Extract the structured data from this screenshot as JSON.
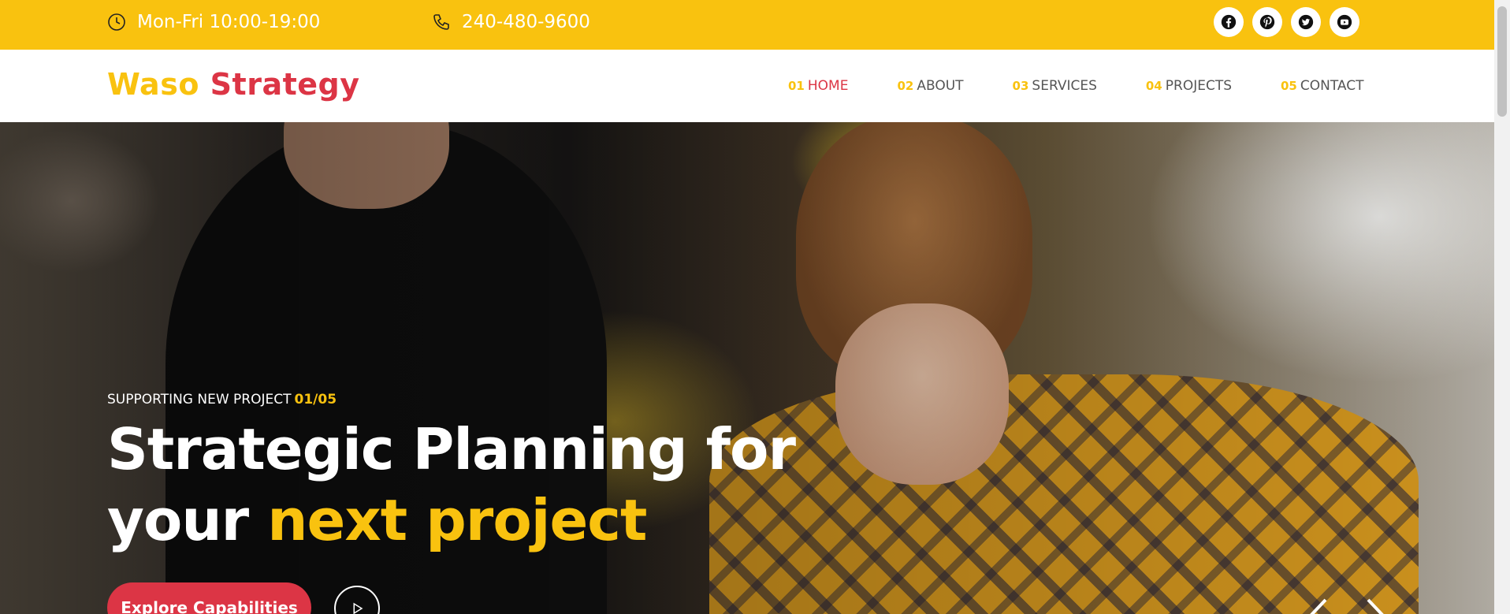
{
  "topbar": {
    "hours": "Mon-Fri 10:00-19:00",
    "phone": "240-480-9600",
    "hours_icon": "clock-icon",
    "phone_icon": "phone-icon",
    "social": [
      "facebook-icon",
      "pinterest-icon",
      "twitter-icon",
      "youtube-icon"
    ],
    "bg_color": "#f9c20f"
  },
  "header": {
    "logo_part1": "Waso",
    "logo_part2": "Strategy",
    "nav": [
      {
        "num": "01",
        "label": "HOME"
      },
      {
        "num": "02",
        "label": "ABOUT"
      },
      {
        "num": "03",
        "label": "SERVICES"
      },
      {
        "num": "04",
        "label": "PROJECTS"
      },
      {
        "num": "05",
        "label": "CONTACT"
      }
    ],
    "active_nav": "HOME"
  },
  "hero": {
    "subtitle": "SUPPORTING NEW PROJECT",
    "counter": "01/05",
    "title_line1": "Strategic Planning for",
    "title_line2_plain": "your",
    "title_line2_highlight": "next project",
    "cta_label": "Explore Capabilities",
    "accent_color": "#f9c20f",
    "cta_color": "#dc3545"
  }
}
